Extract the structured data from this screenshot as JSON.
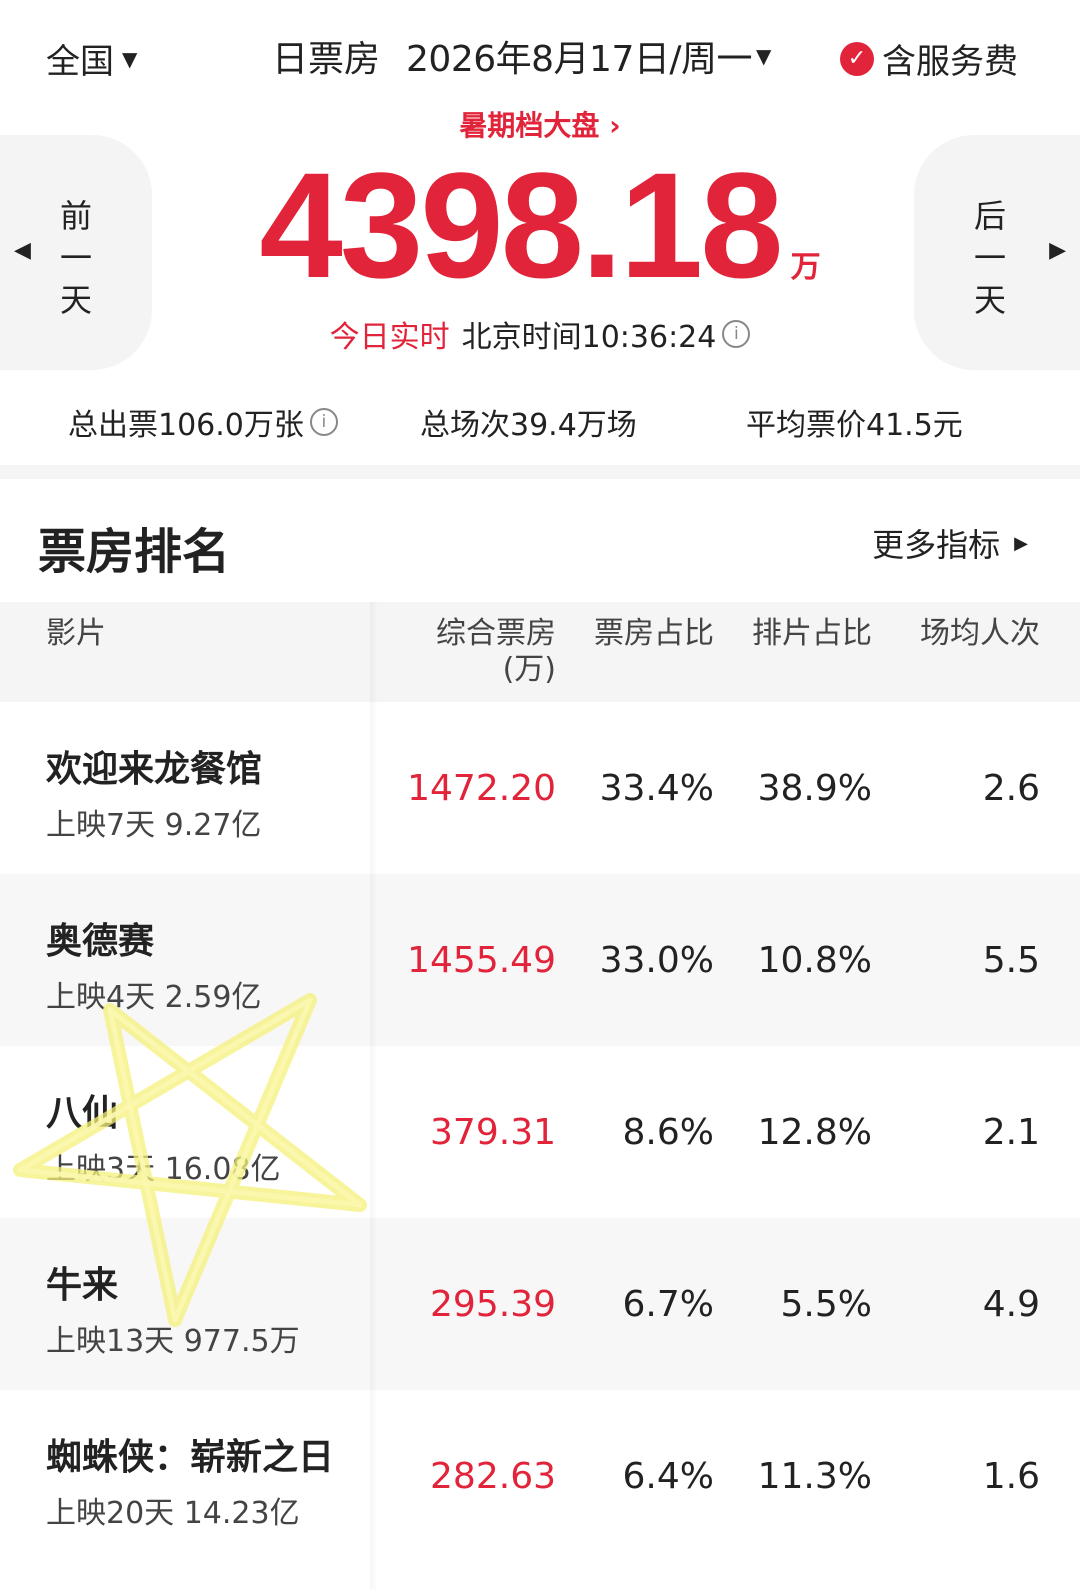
{
  "header": {
    "region": "全国",
    "date_type": "日票房",
    "date": "2026年8月17日/周一",
    "fee_label": "含服务费"
  },
  "hero": {
    "season_link": "暑期档大盘 ›",
    "prev_day": "前\n一\n天",
    "next_day": "后\n一\n天",
    "total_box": "4398.18",
    "unit": "万",
    "realtime_label": "今日实时",
    "beijing_time": "北京时间10:36:24"
  },
  "stats": {
    "tickets": "总出票106.0万张",
    "shows": "总场次39.4万场",
    "avg_price": "平均票价41.5元"
  },
  "ranking": {
    "title": "票房排名",
    "more": "更多指标",
    "columns": {
      "film": "影片",
      "box": "综合票房\n(万)",
      "box_share": "票房占比",
      "schedule_share": "排片占比",
      "avg_people": "场均人次"
    },
    "rows": [
      {
        "name": "欢迎来龙餐馆",
        "sub": "上映7天  9.27亿",
        "box": "1472.20",
        "share": "33.4%",
        "sched": "38.9%",
        "avg": "2.6"
      },
      {
        "name": "奥德赛",
        "sub": "上映4天  2.59亿",
        "box": "1455.49",
        "share": "33.0%",
        "sched": "10.8%",
        "avg": "5.5"
      },
      {
        "name": "八仙",
        "sub": "上映3天  16.08亿",
        "box": "379.31",
        "share": "8.6%",
        "sched": "12.8%",
        "avg": "2.1"
      },
      {
        "name": "牛来",
        "sub": "上映13天  977.5万",
        "box": "295.39",
        "share": "6.7%",
        "sched": "5.5%",
        "avg": "4.9"
      },
      {
        "name": "蜘蛛侠：崭新之日",
        "sub": "上映20天  14.23亿",
        "box": "282.63",
        "share": "6.4%",
        "sched": "11.3%",
        "avg": "1.6"
      }
    ]
  },
  "colors": {
    "accent_red": "#e2243a",
    "star_yellow": "#f4f07a"
  },
  "icons": {
    "region_caret": "caret-down-icon",
    "fee_check": "check-circle-icon",
    "info": "info-circle-icon",
    "prev": "triangle-left-icon",
    "next": "triangle-right-icon"
  }
}
